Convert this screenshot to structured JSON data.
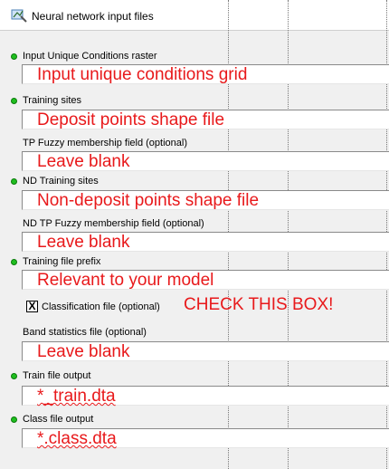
{
  "window": {
    "title": "Neural network input files",
    "icon": "arcgis-tool-icon"
  },
  "fields": [
    {
      "label": "Input Unique Conditions raster",
      "required": true,
      "value": "Input unique conditions grid"
    },
    {
      "label": "Training sites",
      "required": true,
      "value": "Deposit points shape file"
    },
    {
      "label": "TP Fuzzy membership field (optional)",
      "required": false,
      "value": "Leave blank"
    },
    {
      "label": "ND Training sites",
      "required": true,
      "value": "Non-deposit points shape file"
    },
    {
      "label": "ND TP Fuzzy membership field (optional)",
      "required": false,
      "value": "Leave blank"
    },
    {
      "label": "Training file prefix",
      "required": true,
      "value": "Relevant to your model"
    },
    {
      "label": "Band statistics file (optional)",
      "required": false,
      "value": "Leave blank"
    },
    {
      "label": "Train file output",
      "required": true,
      "value": "*_train.dta"
    },
    {
      "label": "Class file output",
      "required": true,
      "value": "*.class.dta"
    }
  ],
  "classification": {
    "checked": true,
    "check_mark": "X",
    "label": "Classification file (optional)",
    "note": "CHECK THIS BOX!"
  },
  "colors": {
    "annotation": "#e8191b",
    "required_dot": "#1fbe1f"
  }
}
